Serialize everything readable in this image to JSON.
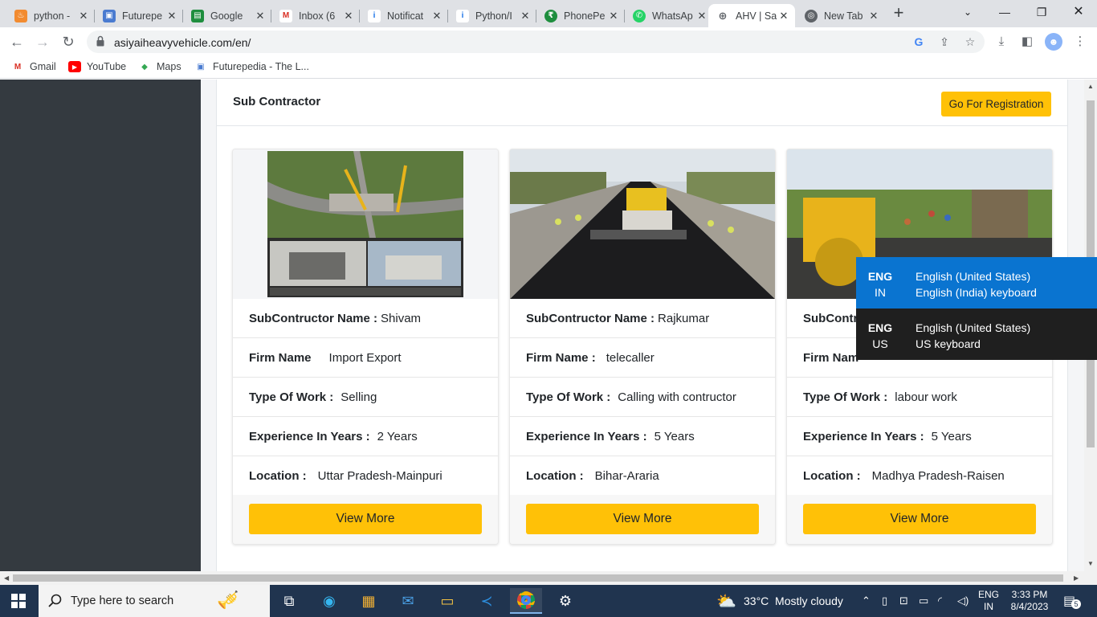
{
  "browser": {
    "tabs": [
      {
        "title": "python -",
        "icon": "python-icon",
        "color": "#f28b30"
      },
      {
        "title": "Futurepe",
        "icon": "futurepedia-icon",
        "color": "#4a7bd0"
      },
      {
        "title": "Google",
        "icon": "google-classroom-icon",
        "color": "#1e8e3e"
      },
      {
        "title": "Inbox (6",
        "icon": "gmail-icon",
        "color": "#d93025"
      },
      {
        "title": "Notificat",
        "icon": "info-icon",
        "color": "#1a73e8"
      },
      {
        "title": "Python/I",
        "icon": "info-icon",
        "color": "#1a73e8"
      },
      {
        "title": "PhonePe",
        "icon": "phonepe-icon",
        "color": "#1e8e3e"
      },
      {
        "title": "WhatsAp",
        "icon": "whatsapp-icon",
        "color": "#25d366"
      },
      {
        "title": "AHV | Sa",
        "icon": "globe-icon",
        "color": "#5f6368",
        "active": true
      },
      {
        "title": "New Tab",
        "icon": "chrome-icon",
        "color": "#5f6368"
      }
    ],
    "url": "asiyaiheavyvehicle.com/en/",
    "bookmarks": [
      {
        "label": "Gmail",
        "icon": "gmail-icon"
      },
      {
        "label": "YouTube",
        "icon": "youtube-icon"
      },
      {
        "label": "Maps",
        "icon": "maps-icon"
      },
      {
        "label": "Futurepedia - The L...",
        "icon": "futurepedia-icon"
      }
    ]
  },
  "page": {
    "section_title": "Sub Contractor",
    "registration_button": "Go For Registration",
    "cards": [
      {
        "name_label": "SubContructor Name :",
        "name": "Shivam",
        "firm_label": "Firm Name",
        "firm": "Import Export",
        "work_label": "Type Of Work :",
        "work": "Selling",
        "exp_label": "Experience In Years :",
        "exp": "2 Years",
        "loc_label": "Location :",
        "loc": "Uttar Pradesh-Mainpuri",
        "button": "View More"
      },
      {
        "name_label": "SubContructor Name :",
        "name": "Rajkumar",
        "firm_label": "Firm Name :",
        "firm": "telecaller",
        "work_label": "Type Of Work :",
        "work": "Calling with contructor",
        "exp_label": "Experience In Years :",
        "exp": "5 Years",
        "loc_label": "Location :",
        "loc": "Bihar-Araria",
        "button": "View More"
      },
      {
        "name_label": "SubContr",
        "name": "",
        "firm_label": "Firm Nam",
        "firm": "",
        "work_label": "Type Of Work :",
        "work": "labour work",
        "exp_label": "Experience In Years :",
        "exp": "5 Years",
        "loc_label": "Location :",
        "loc": "Madhya Pradesh-Raisen",
        "button": "View More"
      }
    ]
  },
  "language_popup": {
    "options": [
      {
        "code1": "ENG",
        "code2": "IN",
        "line1": "English (United States)",
        "line2": "English (India) keyboard",
        "selected": true
      },
      {
        "code1": "ENG",
        "code2": "US",
        "line1": "English (United States)",
        "line2": "US keyboard"
      }
    ]
  },
  "taskbar": {
    "search_placeholder": "Type here to search",
    "weather": "33°C  Mostly cloudy",
    "lang1": "ENG",
    "lang2": "IN",
    "time": "3:33 PM",
    "date": "8/4/2023",
    "notifications": "5"
  },
  "colors": {
    "accent": "#ffc107",
    "sidebar": "#343a40",
    "taskbar": "#20344f",
    "popup_selected": "#0a74d0"
  }
}
